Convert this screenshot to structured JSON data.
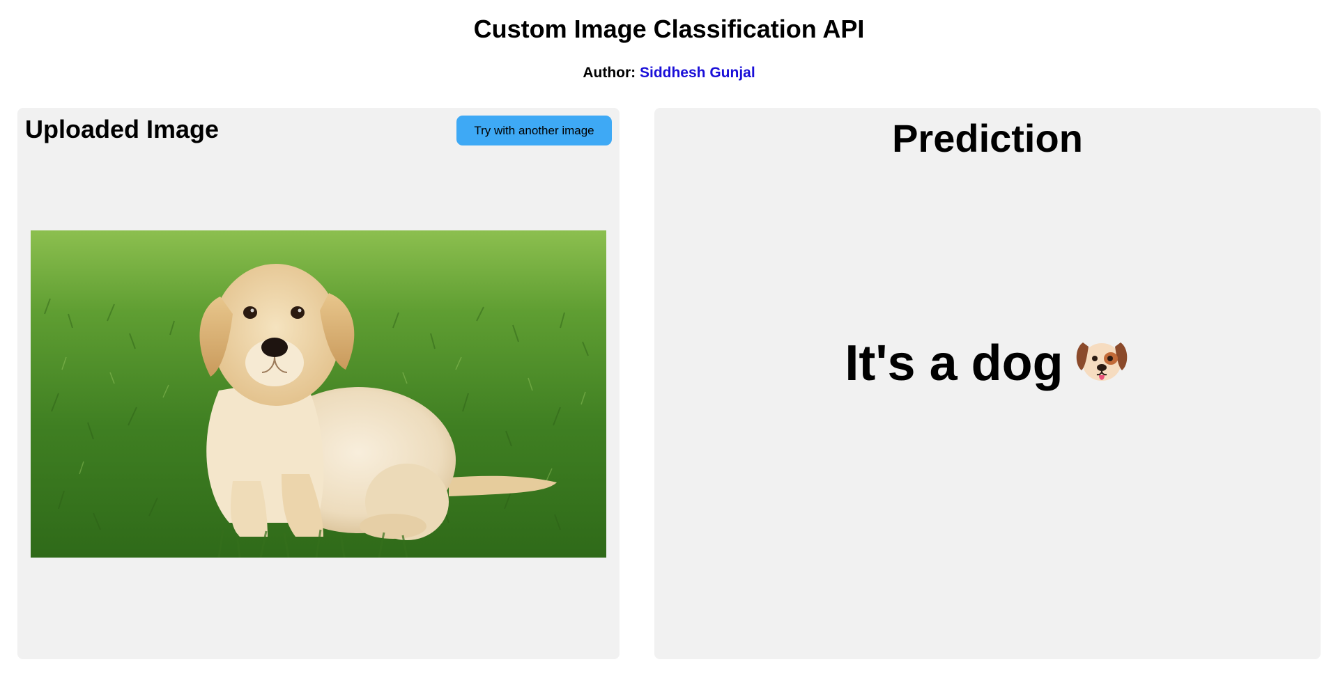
{
  "header": {
    "title": "Custom Image Classification API",
    "author_label": "Author:",
    "author_name": "Siddhesh Gunjal"
  },
  "upload_panel": {
    "title": "Uploaded Image",
    "button_label": "Try with another image",
    "image_subject": "puppy-on-grass"
  },
  "prediction_panel": {
    "title": "Prediction",
    "result_text": "It's a dog",
    "result_icon": "dog-face-icon"
  },
  "colors": {
    "panel_bg": "#f1f1f1",
    "button_bg": "#3ea9f5",
    "author_link": "#1a0fd8"
  }
}
